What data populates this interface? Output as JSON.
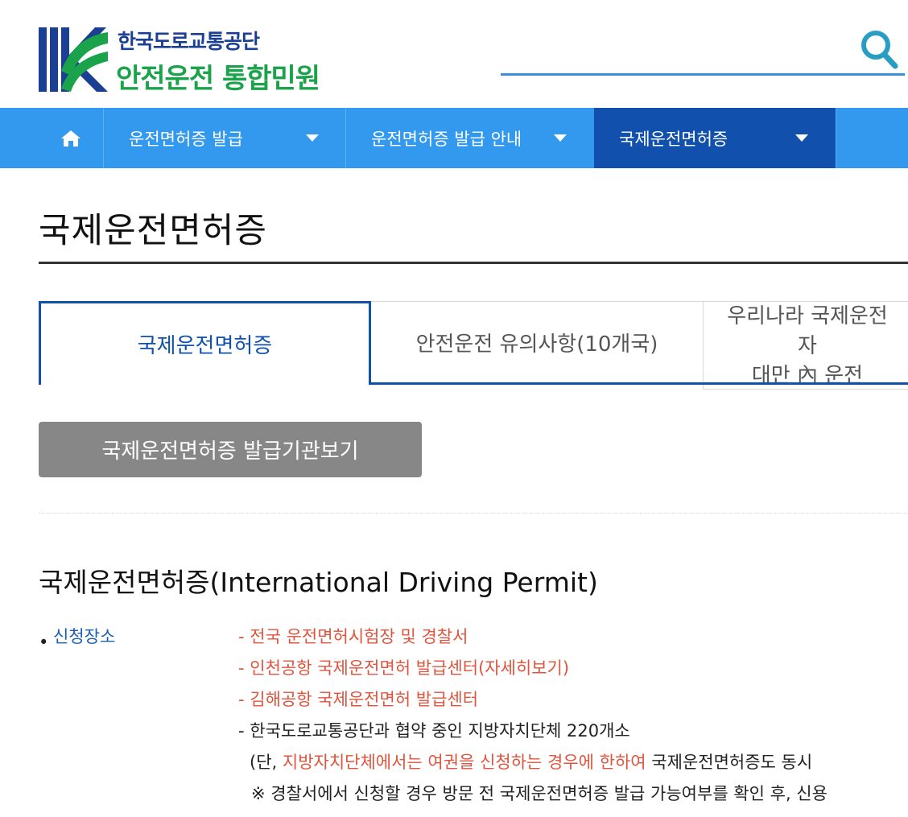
{
  "header": {
    "org_name": "한국도로교통공단",
    "service_name": "안전운전 통합민원"
  },
  "nav": {
    "items": [
      {
        "label": "운전면허증 발급"
      },
      {
        "label": "운전면허증 발급 안내"
      },
      {
        "label": "국제운전면허증"
      }
    ]
  },
  "page": {
    "title": "국제운전면허증"
  },
  "tabs": [
    {
      "label": "국제운전면허증"
    },
    {
      "label": "안전운전 유의사항(10개국)"
    },
    {
      "label_line1": "우리나라 국제운전",
      "label_line2": "자",
      "label_line3": "대만 內 운전"
    }
  ],
  "buttons": {
    "view_agencies": "국제운전면허증 발급기관보기"
  },
  "section": {
    "title": "국제운전면허증(International Driving Permit)",
    "bullet_label": "신청장소",
    "lines": [
      "- 전국 운전면허시험장 및 경찰서",
      "- 인천공항 국제운전면허 발급센터(자세히보기)",
      "- 김해공항 국제운전면허 발급센터",
      "- 한국도로교통공단과 협약 중인 지방자치단체 220개소"
    ],
    "note_prefix": "(단, ",
    "note_red": "지방자치단체에서는 여권을 신청하는 경우에 한하여",
    "note_suffix": " 국제운전면허증도 동시",
    "note2": "※ 경찰서에서 신청할 경우 방문 전 국제운전면허증 발급 가능여부를 확인 후, 신용"
  },
  "colors": {
    "nav_bg": "#3399ee",
    "nav_active": "#1150ad",
    "accent_green": "#1aa34a",
    "accent_navy": "#1a3f93",
    "link_red": "#e0533d"
  }
}
